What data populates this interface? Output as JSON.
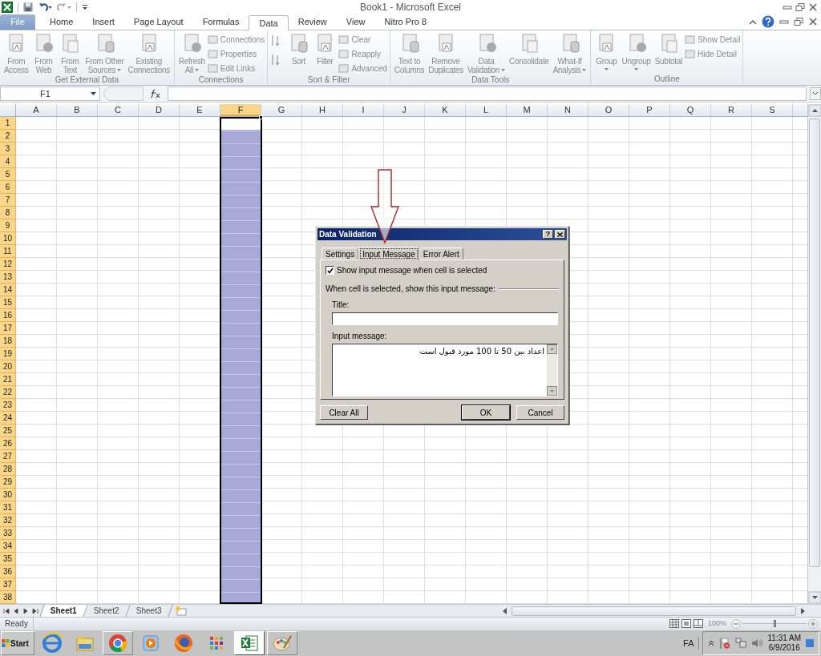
{
  "window": {
    "title": "Book1 - Microsoft Excel"
  },
  "ribbon_tabs": [
    {
      "label": "File",
      "kind": "file",
      "selected": false
    },
    {
      "label": "Home",
      "kind": "tab",
      "selected": false
    },
    {
      "label": "Insert",
      "kind": "tab",
      "selected": false
    },
    {
      "label": "Page Layout",
      "kind": "tab",
      "selected": false
    },
    {
      "label": "Formulas",
      "kind": "tab",
      "selected": false
    },
    {
      "label": "Data",
      "kind": "tab",
      "selected": true
    },
    {
      "label": "Review",
      "kind": "tab",
      "selected": false
    },
    {
      "label": "View",
      "kind": "tab",
      "selected": false
    },
    {
      "label": "Nitro Pro 8",
      "kind": "tab",
      "selected": false
    }
  ],
  "ribbon_groups": [
    {
      "label": "Get External Data",
      "buttons": [
        {
          "kind": "large",
          "lines": [
            "From",
            "Access"
          ],
          "dropdown": false
        },
        {
          "kind": "large",
          "lines": [
            "From",
            "Web"
          ],
          "dropdown": false
        },
        {
          "kind": "large",
          "lines": [
            "From",
            "Text"
          ],
          "dropdown": false
        },
        {
          "kind": "large",
          "lines": [
            "From Other",
            "Sources"
          ],
          "dropdown": true
        },
        {
          "kind": "large",
          "lines": [
            "Existing",
            "Connections"
          ],
          "dropdown": false
        }
      ]
    },
    {
      "label": "Connections",
      "buttons": [
        {
          "kind": "large",
          "lines": [
            "Refresh",
            "All"
          ],
          "dropdown": true
        },
        {
          "kind": "stack",
          "items": [
            "Connections",
            "Properties",
            "Edit Links"
          ]
        }
      ]
    },
    {
      "label": "Sort & Filter",
      "buttons": [
        {
          "kind": "sortpair"
        },
        {
          "kind": "large",
          "lines": [
            "Sort"
          ],
          "dropdown": false
        },
        {
          "kind": "large",
          "lines": [
            "Filter"
          ],
          "dropdown": false
        },
        {
          "kind": "stack",
          "items": [
            "Clear",
            "Reapply",
            "Advanced"
          ]
        }
      ]
    },
    {
      "label": "Data Tools",
      "buttons": [
        {
          "kind": "large",
          "lines": [
            "Text to",
            "Columns"
          ],
          "dropdown": false
        },
        {
          "kind": "large",
          "lines": [
            "Remove",
            "Duplicates"
          ],
          "dropdown": false
        },
        {
          "kind": "large",
          "lines": [
            "Data",
            "Validation"
          ],
          "dropdown": true
        },
        {
          "kind": "large",
          "lines": [
            "Consolidate"
          ],
          "dropdown": false
        },
        {
          "kind": "large",
          "lines": [
            "What-If",
            "Analysis"
          ],
          "dropdown": true
        }
      ]
    },
    {
      "label": "Outline",
      "buttons": [
        {
          "kind": "large",
          "lines": [
            "Group"
          ],
          "dropdown": true
        },
        {
          "kind": "large",
          "lines": [
            "Ungroup"
          ],
          "dropdown": true
        },
        {
          "kind": "large",
          "lines": [
            "Subtotal"
          ],
          "dropdown": false
        },
        {
          "kind": "stack",
          "items": [
            "Show Detail",
            "Hide Detail"
          ]
        }
      ]
    }
  ],
  "formula_bar": {
    "name_box": "F1"
  },
  "grid": {
    "columns": [
      {
        "label": "A",
        "selected": false
      },
      {
        "label": "B",
        "selected": false
      },
      {
        "label": "C",
        "selected": false
      },
      {
        "label": "D",
        "selected": false
      },
      {
        "label": "E",
        "selected": false
      },
      {
        "label": "F",
        "selected": true
      },
      {
        "label": "G",
        "selected": false
      },
      {
        "label": "H",
        "selected": false
      },
      {
        "label": "I",
        "selected": false
      },
      {
        "label": "J",
        "selected": false
      },
      {
        "label": "K",
        "selected": false
      },
      {
        "label": "L",
        "selected": false
      },
      {
        "label": "M",
        "selected": false
      },
      {
        "label": "N",
        "selected": false
      },
      {
        "label": "O",
        "selected": false
      },
      {
        "label": "P",
        "selected": false
      },
      {
        "label": "Q",
        "selected": false
      },
      {
        "label": "R",
        "selected": false
      },
      {
        "label": "S",
        "selected": false
      }
    ],
    "rows": [
      {
        "label": "1",
        "selected": true
      },
      {
        "label": "2",
        "selected": true
      },
      {
        "label": "3",
        "selected": true
      },
      {
        "label": "4",
        "selected": true
      },
      {
        "label": "5",
        "selected": true
      },
      {
        "label": "6",
        "selected": true
      },
      {
        "label": "7",
        "selected": true
      },
      {
        "label": "8",
        "selected": true
      },
      {
        "label": "9",
        "selected": true
      },
      {
        "label": "10",
        "selected": true
      },
      {
        "label": "11",
        "selected": true
      },
      {
        "label": "12",
        "selected": true
      },
      {
        "label": "13",
        "selected": true
      },
      {
        "label": "14",
        "selected": true
      },
      {
        "label": "15",
        "selected": true
      },
      {
        "label": "16",
        "selected": true
      },
      {
        "label": "17",
        "selected": true
      },
      {
        "label": "18",
        "selected": true
      },
      {
        "label": "19",
        "selected": true
      },
      {
        "label": "20",
        "selected": true
      },
      {
        "label": "21",
        "selected": true
      },
      {
        "label": "22",
        "selected": true
      },
      {
        "label": "23",
        "selected": true
      },
      {
        "label": "24",
        "selected": true
      },
      {
        "label": "25",
        "selected": true
      },
      {
        "label": "26",
        "selected": true
      },
      {
        "label": "27",
        "selected": true
      },
      {
        "label": "28",
        "selected": true
      },
      {
        "label": "29",
        "selected": true
      },
      {
        "label": "30",
        "selected": true
      },
      {
        "label": "31",
        "selected": true
      },
      {
        "label": "32",
        "selected": true
      },
      {
        "label": "33",
        "selected": true
      },
      {
        "label": "34",
        "selected": true
      },
      {
        "label": "35",
        "selected": true
      },
      {
        "label": "36",
        "selected": true
      },
      {
        "label": "37",
        "selected": true
      },
      {
        "label": "38",
        "selected": true
      }
    ]
  },
  "sheet_tabs": [
    {
      "label": "Sheet1",
      "selected": true
    },
    {
      "label": "Sheet2",
      "selected": false
    },
    {
      "label": "Sheet3",
      "selected": false
    }
  ],
  "status_bar": {
    "status": "Ready",
    "zoom": {
      "reading": "100%",
      "level": 0.5
    }
  },
  "dialog": {
    "title": "Data Validation",
    "help_button": "?",
    "tabs": [
      {
        "label": "Settings",
        "selected": false
      },
      {
        "label": "Input Message",
        "selected": true
      },
      {
        "label": "Error Alert",
        "selected": false
      }
    ],
    "show_message": {
      "label": "Show input message when cell is selected",
      "checked": true
    },
    "section_label": "When cell is selected, show this input message:",
    "title_label": "Title:",
    "message_label": "Input message:",
    "message_value": "اعداد بین 50 تا 100 مورد قبول است",
    "buttons": [
      {
        "label": "Clear All",
        "kind": "left"
      },
      {
        "label": "OK",
        "kind": "default"
      },
      {
        "label": "Cancel",
        "kind": "normal"
      }
    ]
  },
  "taskbar": {
    "start": "Start",
    "language": "FA",
    "time": "11:31 AM",
    "date": "6/9/2016"
  }
}
